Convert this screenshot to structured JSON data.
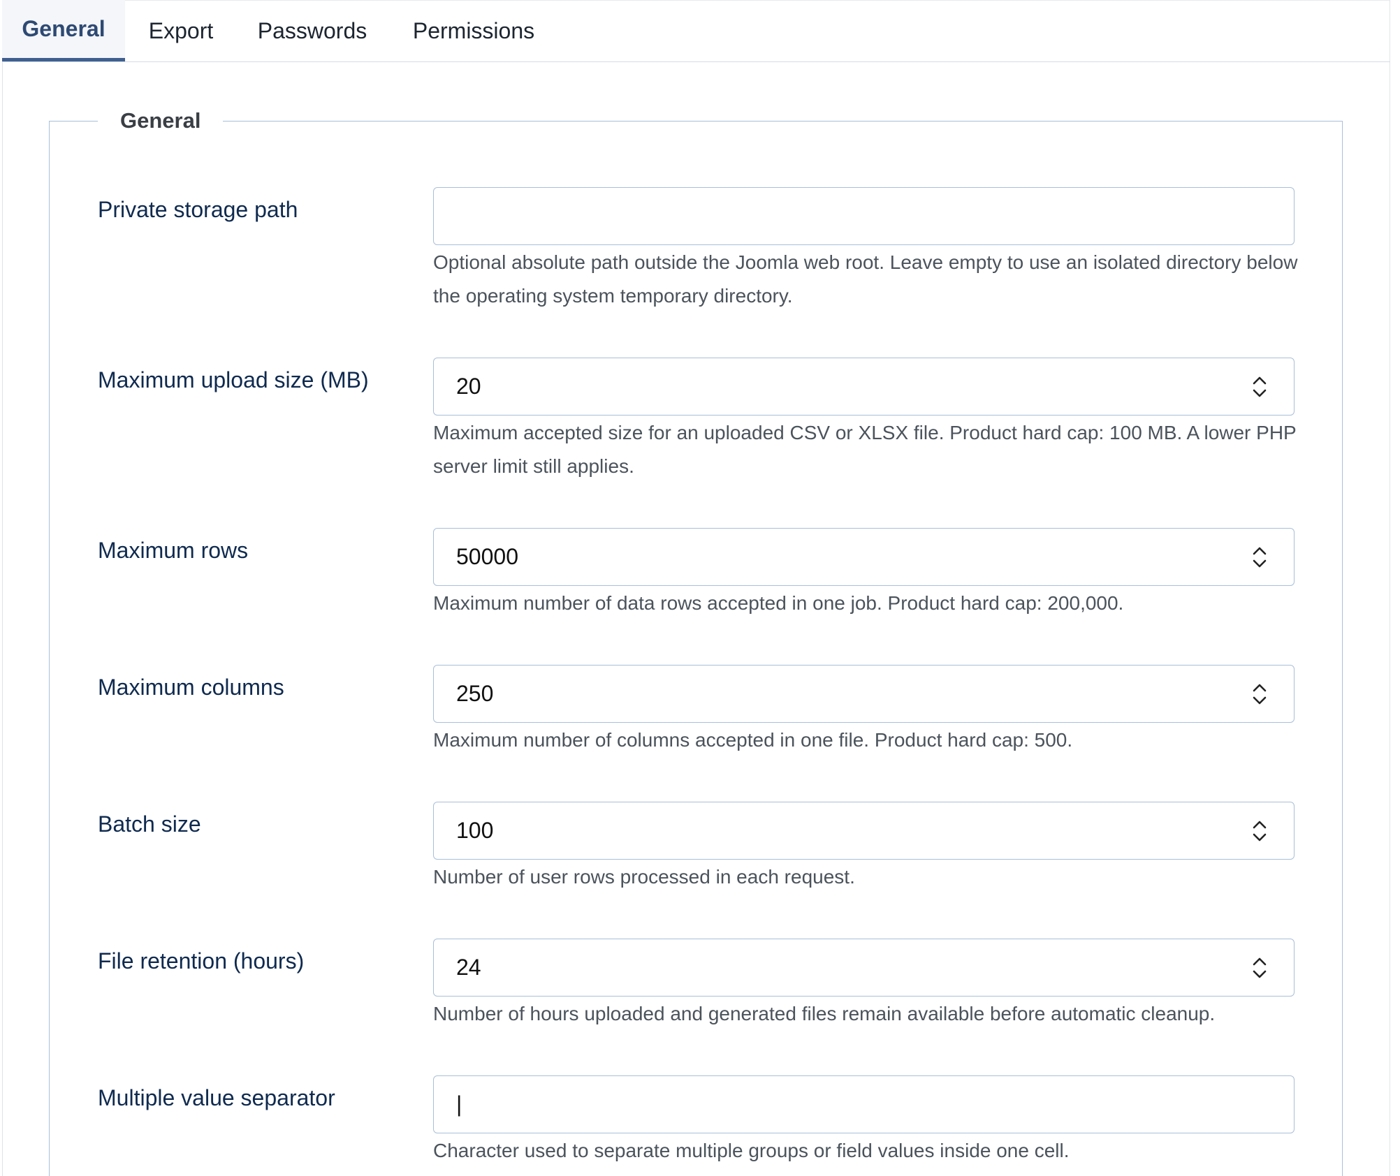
{
  "tabs": [
    {
      "label": "General",
      "active": true
    },
    {
      "label": "Export",
      "active": false
    },
    {
      "label": "Passwords",
      "active": false
    },
    {
      "label": "Permissions",
      "active": false
    }
  ],
  "section": {
    "legend": "General"
  },
  "fields": {
    "private_storage_path": {
      "label": "Private storage path",
      "value": "",
      "help": "Optional absolute path outside the Joomla web root. Leave empty to use an isolated directory below the operating system temporary directory."
    },
    "max_upload_size": {
      "label": "Maximum upload size (MB)",
      "value": "20",
      "help": "Maximum accepted size for an uploaded CSV or XLSX file. Product hard cap: 100 MB. A lower PHP server limit still applies."
    },
    "max_rows": {
      "label": "Maximum rows",
      "value": "50000",
      "help": "Maximum number of data rows accepted in one job. Product hard cap: 200,000."
    },
    "max_columns": {
      "label": "Maximum columns",
      "value": "250",
      "help": "Maximum number of columns accepted in one file. Product hard cap: 500."
    },
    "batch_size": {
      "label": "Batch size",
      "value": "100",
      "help": "Number of user rows processed in each request."
    },
    "file_retention": {
      "label": "File retention (hours)",
      "value": "24",
      "help": "Number of hours uploaded and generated files remain available before automatic cleanup."
    },
    "multi_value_separator": {
      "label": "Multiple value separator",
      "value": "|",
      "help": "Character used to separate multiple groups or field values inside one cell."
    }
  },
  "colors": {
    "accent": "#3f5f8f",
    "label": "#0f2a4f",
    "border": "#a9bfd9"
  },
  "icons": {
    "stepper": "chevron-up-down-icon"
  }
}
